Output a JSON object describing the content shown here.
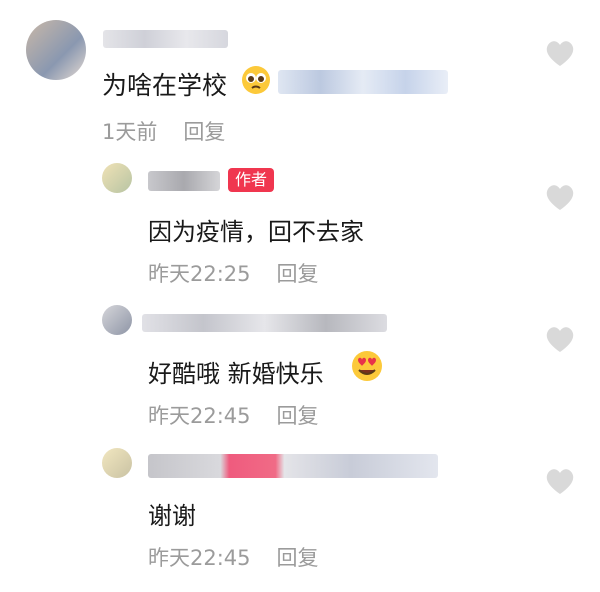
{
  "comments": [
    {
      "text": "为啥在学校",
      "time": "1天前",
      "reply": "回复"
    },
    {
      "text": "因为疫情，回不去家",
      "time": "昨天22:25",
      "reply": "回复",
      "badge": "作者"
    },
    {
      "text": "好酷哦 新婚快乐",
      "time": "昨天22:45",
      "reply": "回复"
    },
    {
      "text": "谢谢",
      "time": "昨天22:45",
      "reply": "回复"
    }
  ],
  "icons": {
    "like": "heart-icon"
  },
  "colors": {
    "badge": "#f0364f",
    "meta": "#9b9b9b",
    "heart": "#d9d9d9"
  }
}
